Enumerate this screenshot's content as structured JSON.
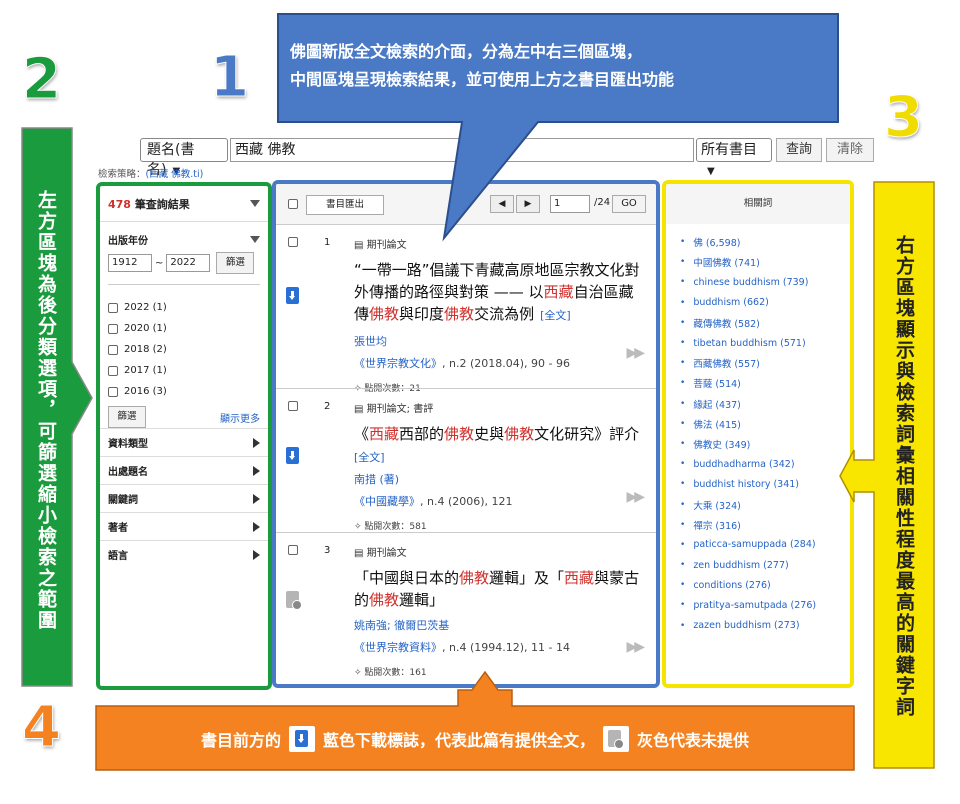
{
  "annotations": {
    "num_left": "2",
    "num_mid": "1",
    "num_right": "3",
    "num_bottom": "4",
    "callout_top_line1": "佛圖新版全文檢索的介面，分為左中右三個區塊，",
    "callout_top_line2": "中間區塊呈現檢索結果，並可使用上方之書目匯出功能",
    "callout_left": "左方區塊為後分類選項，可篩選縮小檢索之範圍",
    "callout_right": "右方區塊顯示與檢索詞彙相關性程度最高的關鍵字詞",
    "callout_bottom_part1": "書目前方的",
    "callout_bottom_part2": "藍色下載標誌，代表此篇有提供全文，",
    "callout_bottom_part3": "灰色代表未提供",
    "colors": {
      "green": "#1a9b3d",
      "blue": "#4a7ac6",
      "yellow": "#f5e400",
      "orange": "#f58220"
    }
  },
  "search": {
    "field_select": "題名(書名)",
    "query": "西藏 佛教",
    "scope_select": "所有書目",
    "search_button": "查詢",
    "clear_button": "清除",
    "strategy_label": "檢索策略：",
    "strategy_value": "(西藏 佛教.ti)"
  },
  "left": {
    "result_count": "478",
    "result_label": "筆查詢結果",
    "year_label": "出版年份",
    "year_from": "1912",
    "year_to": "2022",
    "filter_button": "篩選",
    "years": [
      "2022 (1)",
      "2020 (1)",
      "2018 (2)",
      "2017 (1)",
      "2016 (3)"
    ],
    "filter_button2": "篩選",
    "show_more": "顯示更多",
    "facets": [
      "資料類型",
      "出處題名",
      "關鍵詞",
      "著者",
      "語言"
    ]
  },
  "middle": {
    "export_button": "書目匯出",
    "page_value": "1",
    "page_total": "/24",
    "go_button": "GO",
    "results": [
      {
        "num": "1",
        "type": "期刊論文",
        "title_parts": [
          "“一帶一路”倡議下青藏高原地區宗教文化對外傳播的路徑與對策 —— 以",
          "西藏",
          "自治區藏傳",
          "佛教",
          "與印度",
          "佛教",
          "交流為例"
        ],
        "fulltext": "[全文]",
        "author": "張世均",
        "source_link": "《世界宗教文化》",
        "source_rest": ", n.2 (2018.04), 90 - 96",
        "views": "點閱次數：21"
      },
      {
        "num": "2",
        "type": "期刊論文; 書評",
        "title_parts": [
          "《",
          "西藏",
          "西部的",
          "佛教",
          "史與",
          "佛教",
          "文化研究》評介"
        ],
        "fulltext": "[全文]",
        "author": "南措 (著)",
        "source_link": "《中國藏學》",
        "source_rest": ", n.4 (2006), 121",
        "views": "點閱次數：581"
      },
      {
        "num": "3",
        "type": "期刊論文",
        "title_parts": [
          "「中國與日本的",
          "佛教",
          "邏輯」及「",
          "西藏",
          "與蒙古的",
          "佛教",
          "邏輯」"
        ],
        "fulltext": "",
        "author": "姚南強; 徹爾巴茨基",
        "source_link": "《世界宗教資料》",
        "source_rest": ", n.4 (1994.12), 11 - 14",
        "views": "點閱次數：161"
      }
    ]
  },
  "right": {
    "header": "相關詞",
    "terms": [
      "佛 (6,598)",
      "中國佛教 (741)",
      "chinese buddhism (739)",
      "buddhism (662)",
      "藏傳佛教 (582)",
      "tibetan buddhism (571)",
      "西藏佛教 (557)",
      "菩薩 (514)",
      "緣起 (437)",
      "佛法 (415)",
      "佛教史 (349)",
      "buddhadharma (342)",
      "buddhist history (341)",
      "大乘 (324)",
      "禪宗 (316)",
      "paticca-samuppada (284)",
      "zen buddhism (277)",
      "conditions (276)",
      "pratitya-samutpada (276)",
      "zazen buddhism (273)"
    ]
  }
}
